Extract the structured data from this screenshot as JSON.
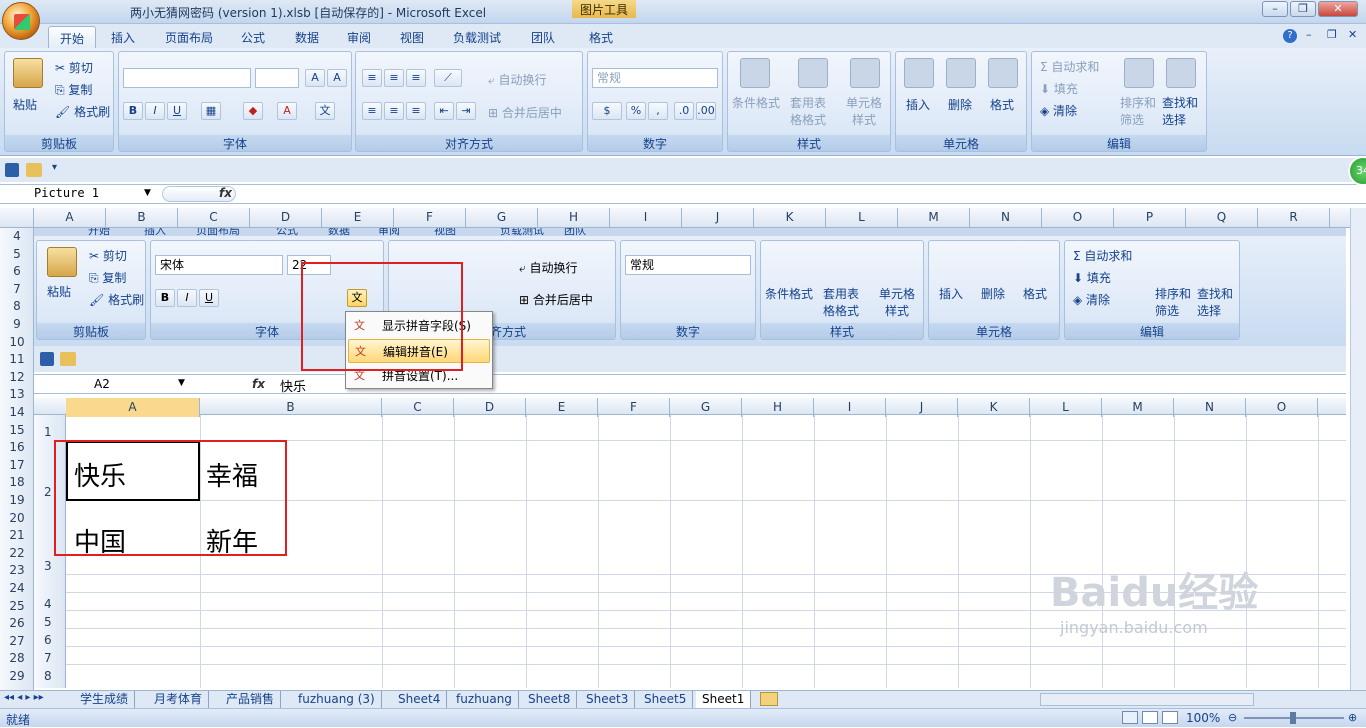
{
  "window": {
    "title": "两小无猜网密码 (version 1).xlsb [自动保存的] - Microsoft Excel",
    "tool_tab": "图片工具"
  },
  "tabs": [
    "开始",
    "插入",
    "页面布局",
    "公式",
    "数据",
    "审阅",
    "视图",
    "负载测试",
    "团队",
    "格式"
  ],
  "ribbon": {
    "clipboard": {
      "paste": "粘贴",
      "cut": "剪切",
      "copy": "复制",
      "format_painter": "格式刷",
      "label": "剪贴板"
    },
    "font": {
      "label": "字体"
    },
    "align": {
      "wrap": "自动换行",
      "merge": "合并后居中",
      "label": "对齐方式"
    },
    "number": {
      "format": "常规",
      "label": "数字"
    },
    "styles": {
      "cond": "条件格式",
      "table": "套用表格格式",
      "cell": "单元格样式",
      "label": "样式"
    },
    "cells": {
      "insert": "插入",
      "delete": "删除",
      "format": "格式",
      "label": "单元格"
    },
    "editing": {
      "autosum": "自动求和",
      "fill": "填充",
      "clear": "清除",
      "sort": "排序和筛选",
      "find": "查找和选择",
      "label": "编辑"
    }
  },
  "name_box": "Picture 1",
  "fx": "fx",
  "col_headers": [
    "A",
    "B",
    "C",
    "D",
    "E",
    "F",
    "G",
    "H",
    "I",
    "J",
    "K",
    "L",
    "M",
    "N",
    "O",
    "P",
    "Q",
    "R"
  ],
  "row_headers": [
    "4",
    "5",
    "6",
    "7",
    "8",
    "9",
    "10",
    "11",
    "12",
    "13",
    "14",
    "15",
    "16",
    "17",
    "18",
    "19",
    "20",
    "21",
    "22",
    "23",
    "24",
    "25",
    "26",
    "27",
    "28",
    "29"
  ],
  "inner": {
    "tabs": [
      "开始",
      "插入",
      "页面布局",
      "公式",
      "数据",
      "审阅",
      "视图",
      "负载测试",
      "团队"
    ],
    "font_name": "宋体",
    "font_size": "22",
    "number_format": "常规",
    "name_box": "A2",
    "formula": "快乐",
    "col_headers": [
      "A",
      "B",
      "C",
      "D",
      "E",
      "F",
      "G",
      "H",
      "I",
      "J",
      "K",
      "L",
      "M",
      "N",
      "O"
    ],
    "row_labels": [
      "1",
      "2",
      "3",
      "4",
      "5",
      "6",
      "7",
      "8"
    ],
    "cells": {
      "a2": "快乐",
      "b2": "幸福",
      "a3": "中国",
      "b3": "新年"
    }
  },
  "menu": {
    "show": "显示拼音字段(S)",
    "edit": "编辑拼音(E)",
    "settings": "拼音设置(T)..."
  },
  "sheets": [
    "学生成绩",
    "月考体育",
    "产品销售",
    "fuzhuang (3)",
    "Sheet4",
    "fuzhuang",
    "Sheet8",
    "Sheet3",
    "Sheet5",
    "Sheet1"
  ],
  "status": {
    "ready": "就绪",
    "zoom": "100%"
  },
  "badge": "34",
  "watermark": {
    "brand": "Baidu经验",
    "url": "jingyan.baidu.com"
  }
}
